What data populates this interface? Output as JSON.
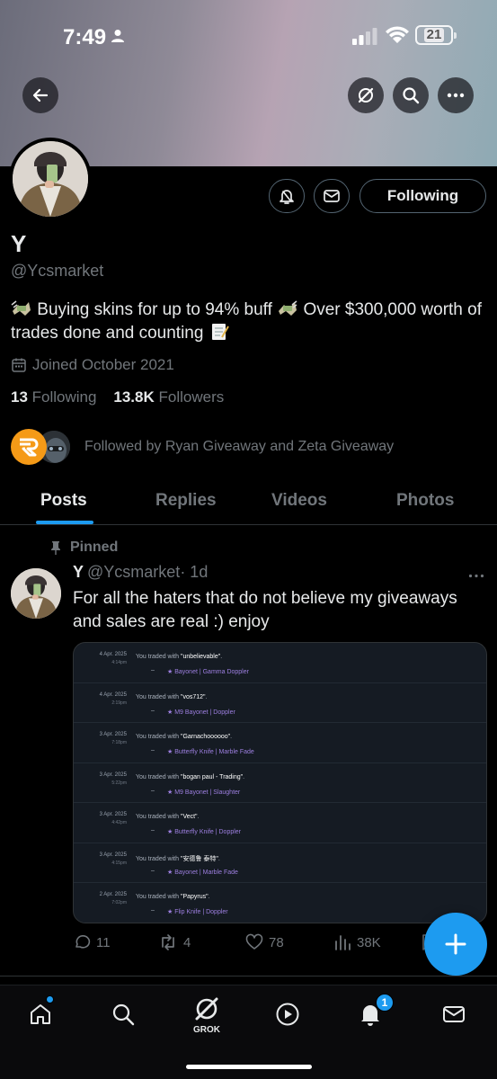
{
  "status_bar": {
    "time": "7:49",
    "battery": "21"
  },
  "profile": {
    "name": "Y",
    "handle": "@Ycsmarket",
    "bio_part1": "Buying skins for up to 94% buff",
    "bio_part2": "Over $300,000 worth of trades done and counting",
    "joined": "Joined October 2021",
    "following_count": "13",
    "following_label": "Following",
    "followers_count": "13.8K",
    "followers_label": "Followers",
    "followed_by": "Followed by Ryan Giveaway and Zeta Giveaway",
    "follow_button_label": "Following"
  },
  "tabs": [
    {
      "label": "Posts"
    },
    {
      "label": "Replies"
    },
    {
      "label": "Videos"
    },
    {
      "label": "Photos"
    }
  ],
  "post": {
    "pinned_label": "Pinned",
    "author_name": "Y",
    "author_handle": "@Ycsmarket",
    "age": "· 1d",
    "text": "For all the haters that do not believe my giveaways and sales are real :) enjoy",
    "trades": [
      {
        "date": "4 Apr. 2025",
        "time": "4:14pm",
        "prefix": "You traded with ",
        "partner": "\"unbelievable\"",
        "dash": "–",
        "item": "★ Bayonet | Gamma Doppler"
      },
      {
        "date": "4 Apr. 2025",
        "time": "2:19pm",
        "prefix": "You traded with ",
        "partner": "\"vos712\"",
        "dash": "–",
        "item": "★ M9 Bayonet | Doppler"
      },
      {
        "date": "3 Apr. 2025",
        "time": "7:18pm",
        "prefix": "You traded with ",
        "partner": "\"Garnachoooooo\"",
        "dash": "–",
        "item": "★ Butterfly Knife | Marble Fade"
      },
      {
        "date": "3 Apr. 2025",
        "time": "5:22pm",
        "prefix": "You traded with ",
        "partner": "\"bogan paul - Trading\"",
        "dash": "–",
        "item": "★ M9 Bayonet | Slaughter"
      },
      {
        "date": "3 Apr. 2025",
        "time": "4:42pm",
        "prefix": "You traded with ",
        "partner": "\"Vect\"",
        "dash": "–",
        "item": "★ Butterfly Knife | Doppler"
      },
      {
        "date": "3 Apr. 2025",
        "time": "4:15pm",
        "prefix": "You traded with ",
        "partner": "\"安德鲁 泰特\"",
        "dash": "–",
        "item": "★ Bayonet | Marble Fade"
      },
      {
        "date": "2 Apr. 2025",
        "time": "7:02pm",
        "prefix": "You traded with ",
        "partner": "\"Papyrus\"",
        "dash": "–",
        "item": "★ Flip Knife | Doppler"
      }
    ],
    "replies": "11",
    "reposts": "4",
    "likes": "78",
    "views": "38K"
  },
  "bottom_nav": {
    "grok_label": "GROK",
    "notifications_badge": "1"
  },
  "colors": {
    "accent": "#1d9bf0",
    "background": "#000000",
    "muted": "#71767b",
    "trade_item": "#9d7fe0"
  }
}
